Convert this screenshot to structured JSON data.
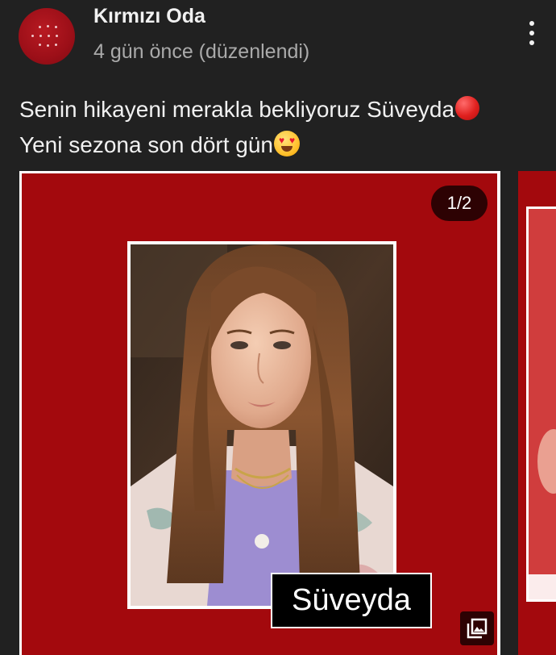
{
  "channel": {
    "name": "Kırmızı Oda",
    "time": "4 gün önce (düzenlendi)"
  },
  "post": {
    "line1": "Senin hikayeni merakla bekliyoruz Süveyda",
    "line2": "Yeni sezona son dört gün"
  },
  "carousel": {
    "counter": "1/2",
    "caption": "Süveyda"
  },
  "colors": {
    "background": "#212121",
    "brand_red": "#a3090d",
    "muted_text": "#aaaaaa"
  },
  "icons": [
    "more-vertical-icon",
    "red-circle-emoji",
    "heart-eyes-emoji",
    "gallery-icon"
  ]
}
